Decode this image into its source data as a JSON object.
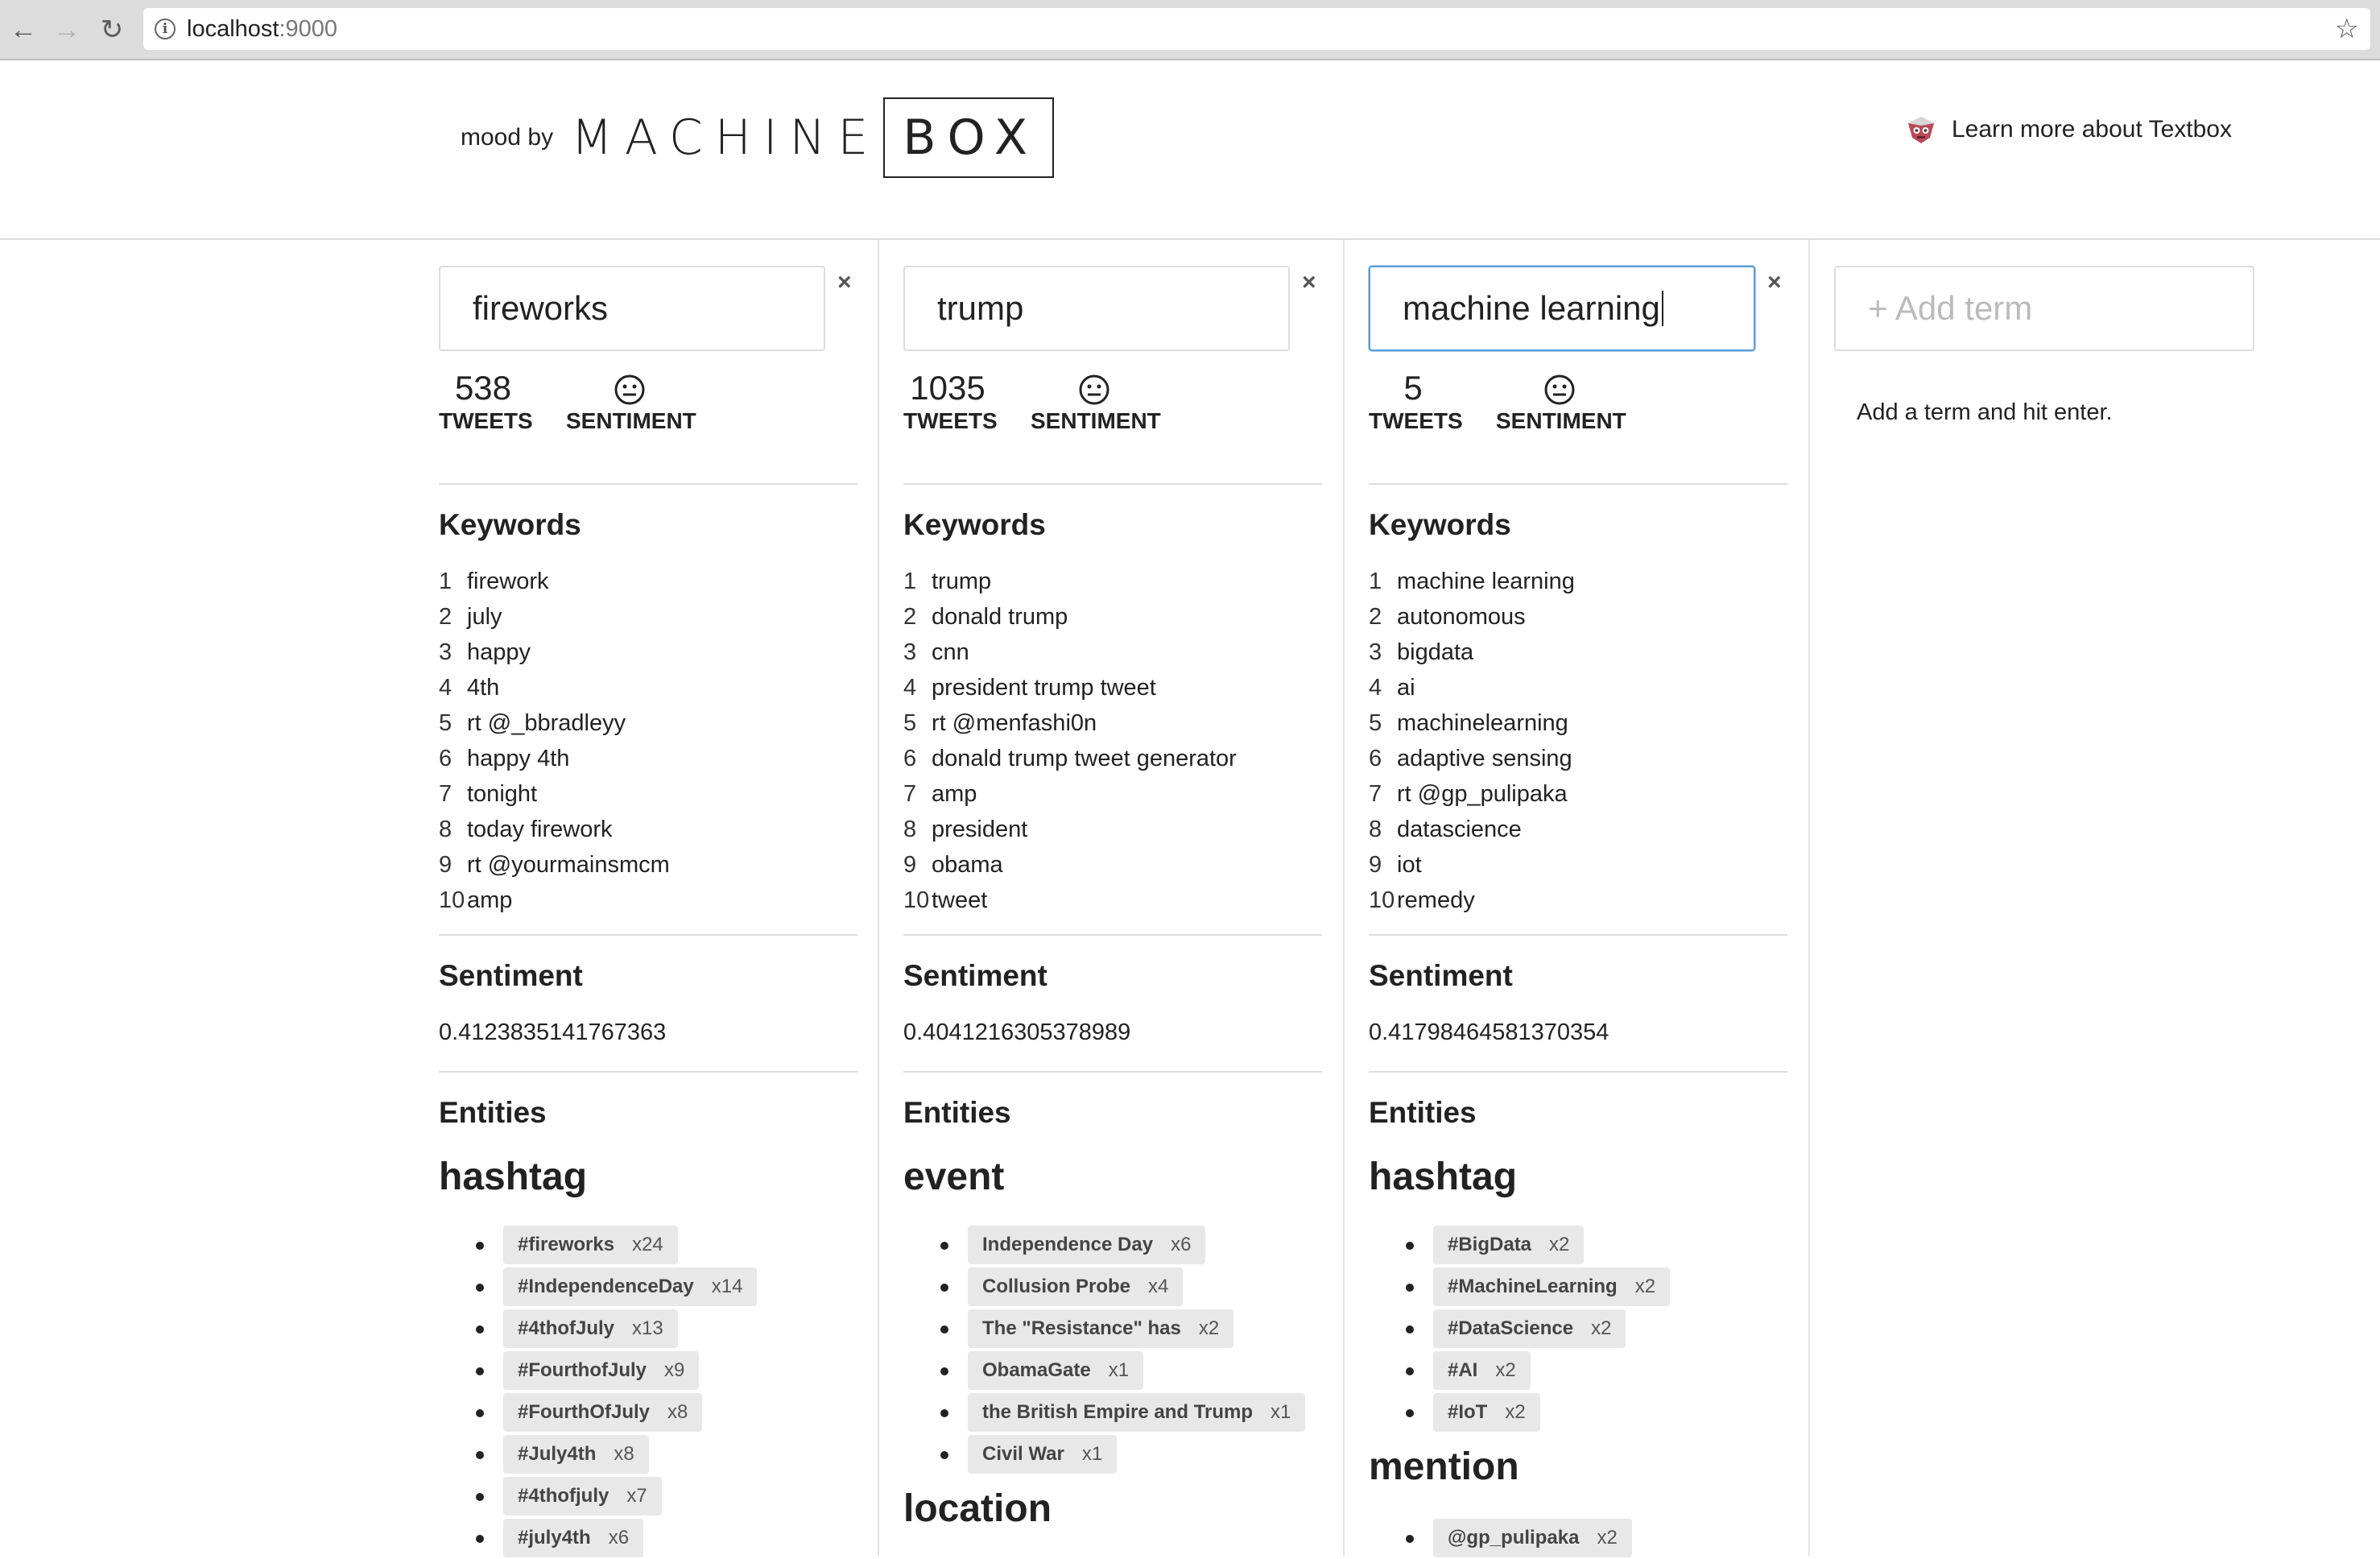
{
  "browser": {
    "url_host": "localhost",
    "url_port": ":9000"
  },
  "header": {
    "mood_by": "mood by",
    "brand_machine": "MACHINE",
    "brand_box": "BOX",
    "learn_more": "Learn more about Textbox"
  },
  "labels": {
    "tweets": "TWEETS",
    "sentiment": "SENTIMENT",
    "keywords": "Keywords",
    "sentiment_heading": "Sentiment",
    "entities": "Entities",
    "close": "×"
  },
  "add_term": {
    "placeholder": "+ Add term",
    "hint": "Add a term and hit enter."
  },
  "columns": [
    {
      "term": "fireworks",
      "tweets": "538",
      "keywords": [
        "firework",
        "july",
        "happy",
        "4th",
        "rt @_bbradleyy",
        "happy 4th",
        "tonight",
        "today firework",
        "rt @yourmainsmcm",
        "amp"
      ],
      "sentiment": "0.4123835141767363",
      "entity_groups": [
        {
          "type": "hashtag",
          "items": [
            {
              "name": "#fireworks",
              "count": "x24"
            },
            {
              "name": "#IndependenceDay",
              "count": "x14"
            },
            {
              "name": "#4thofJuly",
              "count": "x13"
            },
            {
              "name": "#FourthofJuly",
              "count": "x9"
            },
            {
              "name": "#FourthOfJuly",
              "count": "x8"
            },
            {
              "name": "#July4th",
              "count": "x8"
            },
            {
              "name": "#4thofjuly",
              "count": "x7"
            },
            {
              "name": "#july4th",
              "count": "x6"
            }
          ]
        }
      ]
    },
    {
      "term": "trump",
      "tweets": "1035",
      "keywords": [
        "trump",
        "donald trump",
        "cnn",
        "president trump tweet",
        "rt @menfashi0n",
        "donald trump tweet generator",
        "amp",
        "president",
        "obama",
        "tweet"
      ],
      "sentiment": "0.4041216305378989",
      "entity_groups": [
        {
          "type": "event",
          "items": [
            {
              "name": "Independence Day",
              "count": "x6"
            },
            {
              "name": "Collusion Probe",
              "count": "x4"
            },
            {
              "name": "The \"Resistance\" has",
              "count": "x2"
            },
            {
              "name": "ObamaGate",
              "count": "x1"
            },
            {
              "name": "the British Empire and Trump",
              "count": "x1"
            },
            {
              "name": "Civil War",
              "count": "x1"
            }
          ]
        },
        {
          "type": "location",
          "items": []
        }
      ]
    },
    {
      "term": "machine learning",
      "tweets": "5",
      "keywords": [
        "machine learning",
        "autonomous",
        "bigdata",
        "ai",
        "machinelearning",
        "adaptive sensing",
        "rt @gp_pulipaka",
        "datascience",
        "iot",
        "remedy"
      ],
      "sentiment": "0.41798464581370354",
      "entity_groups": [
        {
          "type": "hashtag",
          "items": [
            {
              "name": "#BigData",
              "count": "x2"
            },
            {
              "name": "#MachineLearning",
              "count": "x2"
            },
            {
              "name": "#DataScience",
              "count": "x2"
            },
            {
              "name": "#AI",
              "count": "x2"
            },
            {
              "name": "#IoT",
              "count": "x2"
            }
          ]
        },
        {
          "type": "mention",
          "items": [
            {
              "name": "@gp_pulipaka",
              "count": "x2"
            }
          ]
        }
      ]
    }
  ]
}
